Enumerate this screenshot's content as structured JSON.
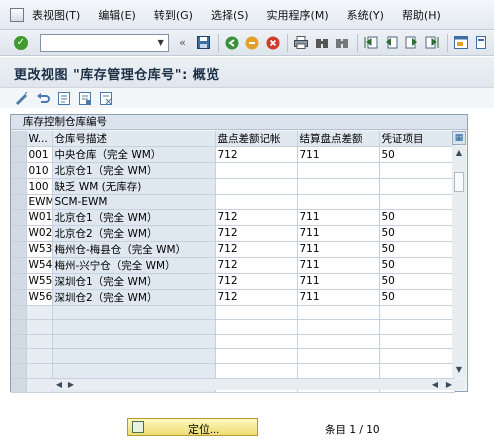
{
  "menu": {
    "items": [
      "表视图(T)",
      "编辑(E)",
      "转到(G)",
      "选择(S)",
      "实用程序(M)",
      "系统(Y)",
      "帮助(H)"
    ]
  },
  "toolbar": {
    "command_value": "",
    "collapse_symbol": "«"
  },
  "title": "更改视图 \"库存管理仓库号\": 概览",
  "panel": {
    "caption": "库存控制仓库编号",
    "columns": [
      "W...",
      "仓库号描述",
      "盘点差额记帐",
      "结算盘点差额",
      "凭证项目"
    ],
    "rows": [
      [
        "001",
        "中央仓库（完全 WM）",
        "712",
        "711",
        "50"
      ],
      [
        "010",
        "北京仓1（完全 WM）",
        "",
        "",
        ""
      ],
      [
        "100",
        "缺乏 WM (无库存)",
        "",
        "",
        ""
      ],
      [
        "EWM",
        "SCM-EWM",
        "",
        "",
        ""
      ],
      [
        "W01",
        "北京仓1（完全 WM）",
        "712",
        "711",
        "50"
      ],
      [
        "W02",
        "北京仓2（完全 WM）",
        "712",
        "711",
        "50"
      ],
      [
        "W53",
        "梅州仓-梅县仓（完全 WM）",
        "712",
        "711",
        "50"
      ],
      [
        "W54",
        "梅州-兴宁仓（完全 WM）",
        "712",
        "711",
        "50"
      ],
      [
        "W55",
        "深圳仓1（完全 WM）",
        "712",
        "711",
        "50"
      ],
      [
        "W56",
        "深圳仓2（完全 WM）",
        "712",
        "711",
        "50"
      ]
    ]
  },
  "footer": {
    "position_button": "定位...",
    "entry_count": "条目 1 / 10"
  }
}
